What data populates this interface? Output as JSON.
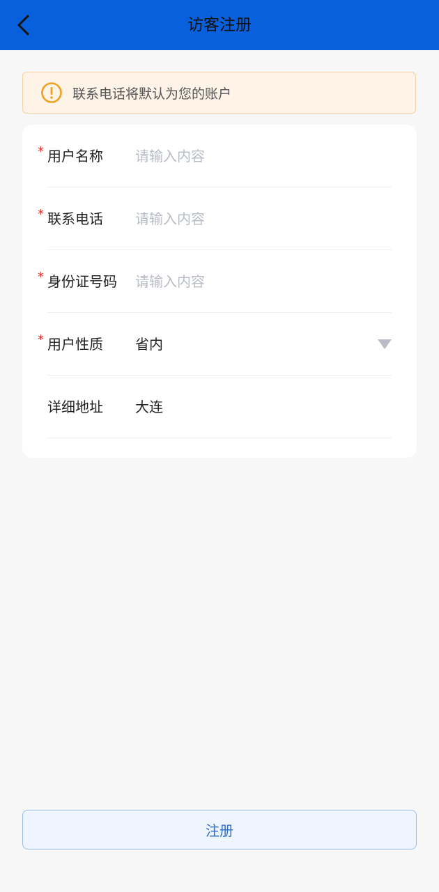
{
  "header": {
    "title": "访客注册",
    "back_icon": "chevron-left-icon",
    "background": "#0860dc"
  },
  "notice": {
    "icon": "warning-circle-icon",
    "text": "联系电话将默认为您的账户",
    "accent": "#f0a020"
  },
  "form": {
    "fields": [
      {
        "label": "用户名称",
        "required": "*",
        "placeholder": "请输入内容",
        "value": ""
      },
      {
        "label": "联系电话",
        "required": "*",
        "placeholder": "请输入内容",
        "value": ""
      },
      {
        "label": "身份证号码",
        "required": "*",
        "placeholder": "请输入内容",
        "value": ""
      },
      {
        "label": "用户性质",
        "required": "*",
        "value": "省内",
        "dropdown_icon": "triangle-down-icon"
      },
      {
        "label": "详细地址",
        "value": "大连"
      }
    ]
  },
  "submit": {
    "label": "注册"
  }
}
